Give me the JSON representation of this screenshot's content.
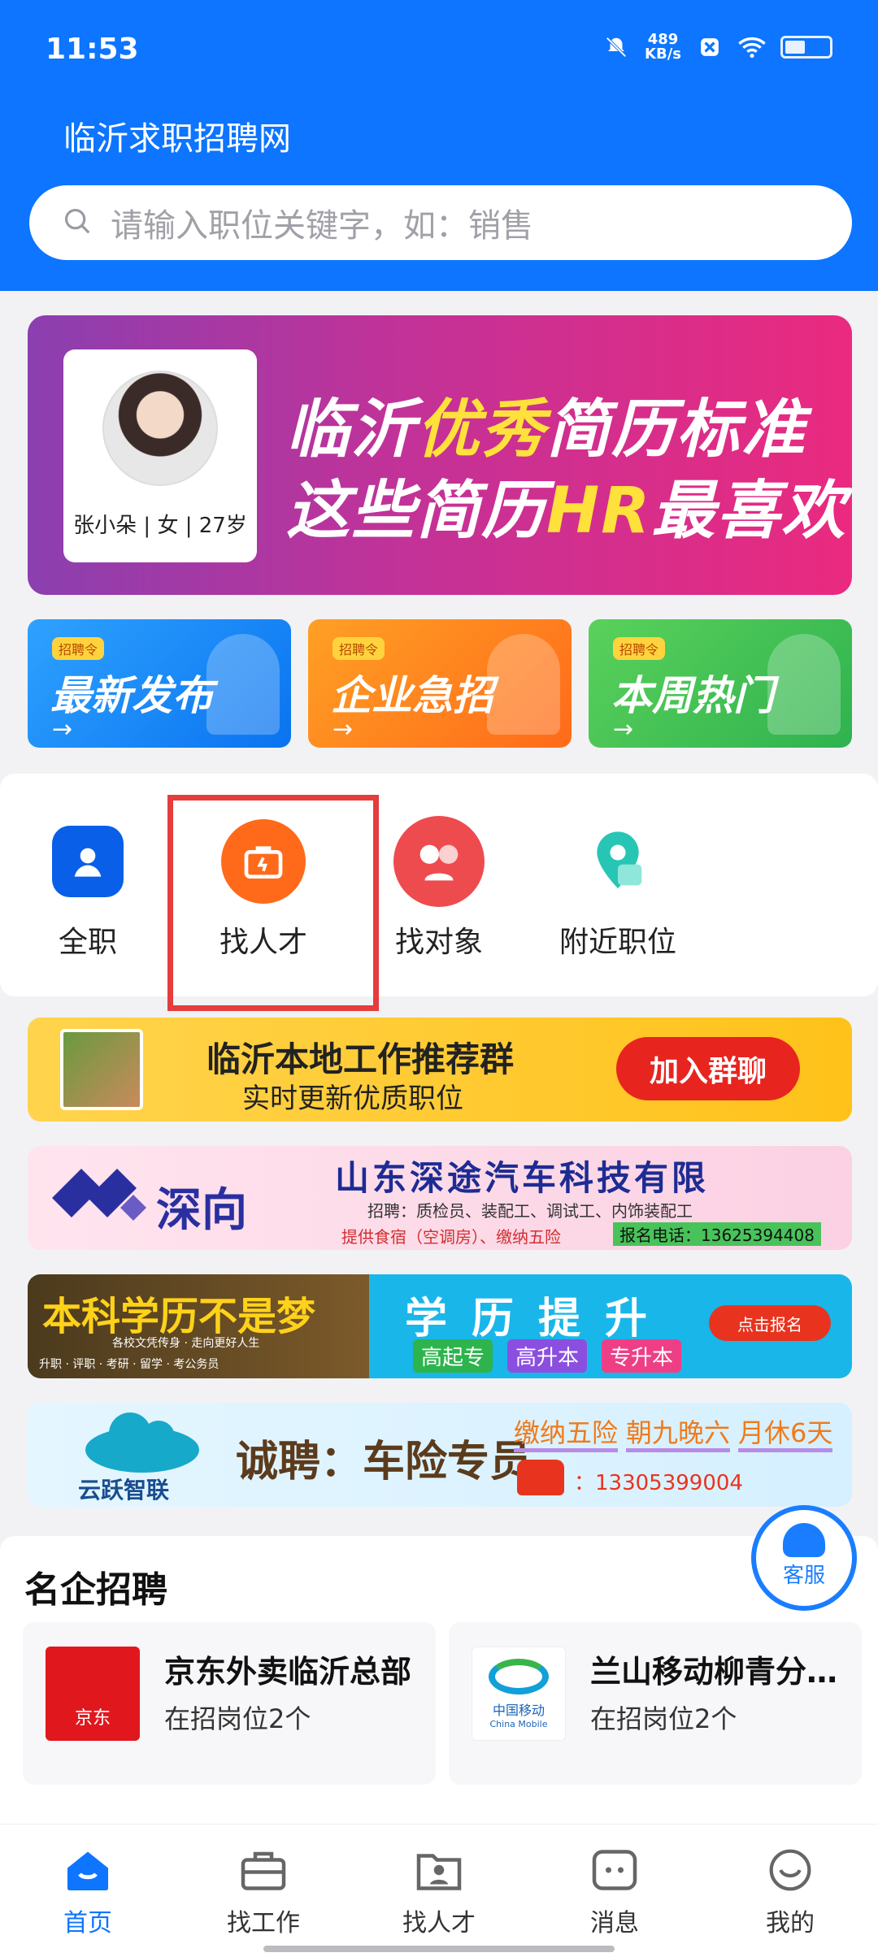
{
  "status_bar": {
    "time": "11:53",
    "net_speed_value": "489",
    "net_speed_unit": "KB/s"
  },
  "header": {
    "title": "临沂求职招聘网",
    "search_placeholder": "请输入职位关键字，如：销售"
  },
  "banner": {
    "profile_text": "张小朵 | 女 | 27岁",
    "line1_a": "临沂",
    "line1_b": "优秀",
    "line1_c": "简历标准",
    "line2_a": "这些简历",
    "line2_b": "HR",
    "line2_c": "最喜欢"
  },
  "promos": [
    {
      "tag": "招聘令",
      "title": "最新发布",
      "arrow": "→"
    },
    {
      "tag": "招聘令",
      "title": "企业急招",
      "arrow": "→"
    },
    {
      "tag": "招聘令",
      "title": "本周热门",
      "arrow": "→"
    }
  ],
  "quick_links": [
    {
      "label": "全职"
    },
    {
      "label": "找人才"
    },
    {
      "label": "找对象"
    },
    {
      "label": "附近职位"
    }
  ],
  "ads": {
    "group": {
      "title": "临沂本地工作推荐群",
      "subtitle": "实时更新优质职位",
      "button": "加入群聊"
    },
    "shenxiang": {
      "brand": "深向",
      "title": "山东深途汽车科技有限",
      "line1": "招聘：质检员、装配工、调试工、内饰装配工",
      "line2": "提供食宿（空调房）、缴纳五险",
      "phone": "报名电话：13625394408"
    },
    "education": {
      "left_title": "本科学历不是梦",
      "left_sub": "各校文凭传身 · 走向更好人生",
      "left_items": "升职 · 评职 · 考研 · 留学 · 考公务员",
      "title": "学历提升",
      "chips": [
        "高起专",
        "高升本",
        "专升本"
      ],
      "cta": "点击报名"
    },
    "yunyue": {
      "brand": "云跃智联",
      "title": "诚聘：车险专员",
      "perks": [
        "缴纳五险",
        "朝九晚六",
        "月休6天"
      ],
      "phone": "：13305399004"
    }
  },
  "section": {
    "title": "名企招聘",
    "companies": [
      {
        "name": "京东外卖临沂总部",
        "info": "在招岗位2个",
        "logo_text": "京东"
      },
      {
        "name": "兰山移动柳青分…",
        "info": "在招岗位2个",
        "logo_text": "中国移动",
        "logo_sub": "China Mobile"
      }
    ]
  },
  "floating": {
    "kefu": "客服"
  },
  "nav": [
    {
      "label": "首页"
    },
    {
      "label": "找工作"
    },
    {
      "label": "找人才"
    },
    {
      "label": "消息"
    },
    {
      "label": "我的"
    }
  ],
  "colors": {
    "primary": "#0d75ff",
    "highlight_box": "#e53c3c"
  }
}
